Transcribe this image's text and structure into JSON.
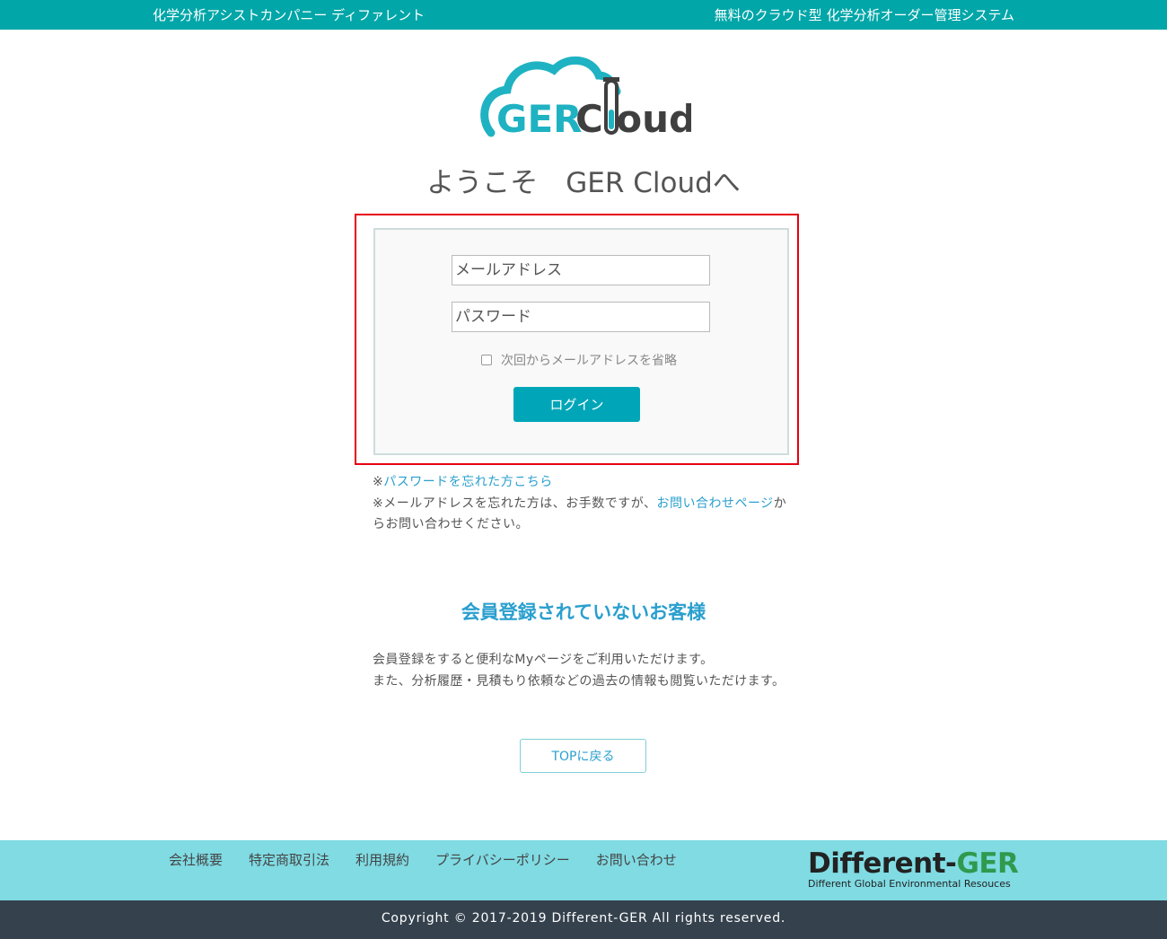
{
  "topbar": {
    "left_text": "化学分析アシストカンパニー ディファレント",
    "right_text": "無料のクラウド型 化学分析オーダー管理システム"
  },
  "logo": {
    "text_ger": "GER",
    "text_cloud": "Cloud"
  },
  "welcome": "ようこそ　GER Cloudへ",
  "login": {
    "email_placeholder": "メールアドレス",
    "password_placeholder": "パスワード",
    "remember_label": "次回からメールアドレスを省略",
    "login_button": "ログイン"
  },
  "notes": {
    "forgot_prefix": "※",
    "forgot_password_link": "パスワードを忘れた方こちら",
    "forgot_email_prefix": "※メールアドレスを忘れた方は、お手数ですが、",
    "contact_link": "お問い合わせページ",
    "forgot_email_suffix": "からお問い合わせください。"
  },
  "member": {
    "title": "会員登録されていないお客様",
    "line1": "会員登録をすると便利なMyページをご利用いただけます。",
    "line2": "また、分析履歴・見積もり依頼などの過去の情報も閲覧いただけます。",
    "top_button": "TOPに戻る"
  },
  "footer": {
    "links": [
      "会社概要",
      "特定商取引法",
      "利用規約",
      "プライバシーポリシー",
      "お問い合わせ"
    ],
    "brand_main": "Different-",
    "brand_accent": "GER",
    "brand_sub": "Different Global Environmental Resouces"
  },
  "copyright": "Copyright © 2017-2019 Different-GER All rights reserved.",
  "colors": {
    "topbar": "#00a6a8",
    "accent_link": "#2a9fce",
    "login_button": "#00a6b8",
    "highlight_border": "#e60012",
    "footer_bg": "#80dbe3",
    "copyright_bg": "#35424e",
    "brand_green": "#2f9a4e"
  }
}
